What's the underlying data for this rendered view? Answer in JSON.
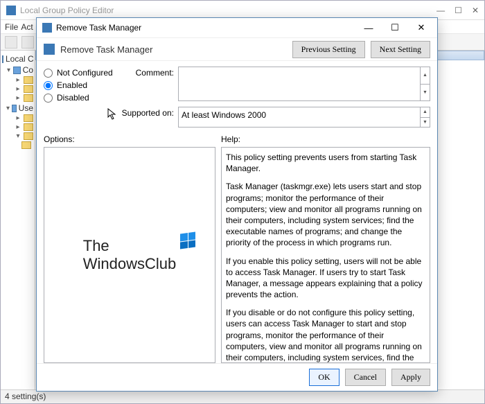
{
  "parent_window": {
    "title": "Local Group Policy Editor",
    "menu": {
      "file": "File",
      "action": "Act"
    },
    "tree": {
      "root": "Local C",
      "item1": "Co",
      "item4": "Use"
    },
    "statusbar": "4 setting(s)"
  },
  "dialog": {
    "title": "Remove Task Manager",
    "subtitle": "Remove Task Manager",
    "nav": {
      "prev": "Previous Setting",
      "next": "Next Setting"
    },
    "radios": {
      "not_configured": "Not Configured",
      "enabled": "Enabled",
      "disabled": "Disabled",
      "selected": "enabled"
    },
    "comment_label": "Comment:",
    "comment_value": "",
    "supported_label": "Supported on:",
    "supported_value": "At least Windows 2000",
    "options_label": "Options:",
    "help_label": "Help:",
    "help_p1": "This policy setting prevents users from starting Task Manager.",
    "help_p2": "Task Manager (taskmgr.exe) lets users start and stop programs; monitor the performance of their computers; view and monitor all programs running on their computers, including system services; find the executable names of programs; and change the priority of the process in which programs run.",
    "help_p3": "If you enable this policy setting, users will not be able to access Task Manager. If users try to start Task Manager, a message appears explaining that a policy prevents the action.",
    "help_p4": "If you disable or do not configure this policy setting, users can access Task Manager to  start and stop programs, monitor the performance of their computers, view and monitor all programs running on their computers, including system services, find the executable names of programs, and change the priority of the process in which programs run.",
    "buttons": {
      "ok": "OK",
      "cancel": "Cancel",
      "apply": "Apply"
    },
    "watermark": {
      "line1": "The",
      "line2": "WindowsClub"
    }
  }
}
